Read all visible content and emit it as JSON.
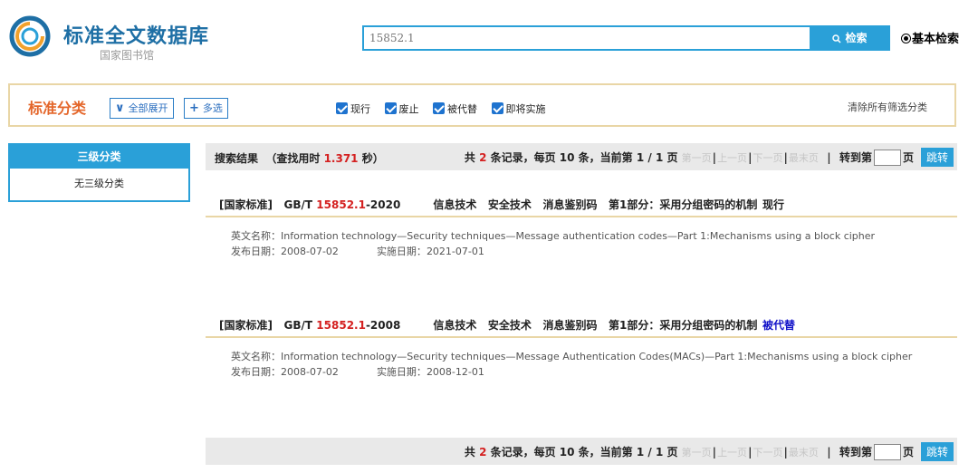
{
  "header": {
    "title": "标准全文数据库",
    "subtitle": "国家图书馆",
    "search_value": "15852.1",
    "search_button": "检索",
    "basic_search": "基本检索"
  },
  "filters": {
    "title": "标准分类",
    "expand_all": "全部展开",
    "multi_select": "多选",
    "checkboxes": [
      "现行",
      "废止",
      "被代替",
      "即将实施"
    ],
    "clear_all": "清除所有筛选分类"
  },
  "sidebar": {
    "heading": "三级分类",
    "item": "无三级分类"
  },
  "results_info": {
    "label": "搜索结果",
    "time_prefix": "（查找用时",
    "time_value": "1.371",
    "time_suffix": "秒）"
  },
  "pager": {
    "total_prefix": "共",
    "total": "2",
    "total_suffix": "条记录，每页 10 条，当前第 1 / 1 页",
    "first": "第一页",
    "prev": "上一页",
    "next": "下一页",
    "last": "最末页",
    "goto_prefix": "转到第",
    "goto_suffix": "页",
    "jump": "跳转"
  },
  "results": [
    {
      "category": "[国家标准]",
      "code_prefix": "GB/T",
      "code_highlight": "15852.1",
      "code_suffix": "-2020",
      "parts": [
        "信息技术",
        "安全技术",
        "消息鉴别码",
        "第1部分：采用分组密码的机制"
      ],
      "status": "现行",
      "en_label": "英文名称：",
      "en_name": "Information technology—Security techniques—Message authentication codes—Part 1:Mechanisms using a block cipher",
      "pub_label": "发布日期：",
      "pub_date": "2008-07-02",
      "impl_label": "实施日期：",
      "impl_date": "2021-07-01"
    },
    {
      "category": "[国家标准]",
      "code_prefix": "GB/T",
      "code_highlight": "15852.1",
      "code_suffix": "-2008",
      "parts": [
        "信息技术",
        "安全技术",
        "消息鉴别码",
        "第1部分：采用分组密码的机制"
      ],
      "status": "被代替",
      "en_label": "英文名称：",
      "en_name": "Information technology—Security techniques—Message Authentication Codes(MACs)—Part 1:Mechanisms using a block cipher",
      "pub_label": "发布日期：",
      "pub_date": "2008-07-02",
      "impl_label": "实施日期：",
      "impl_date": "2008-12-01"
    }
  ]
}
